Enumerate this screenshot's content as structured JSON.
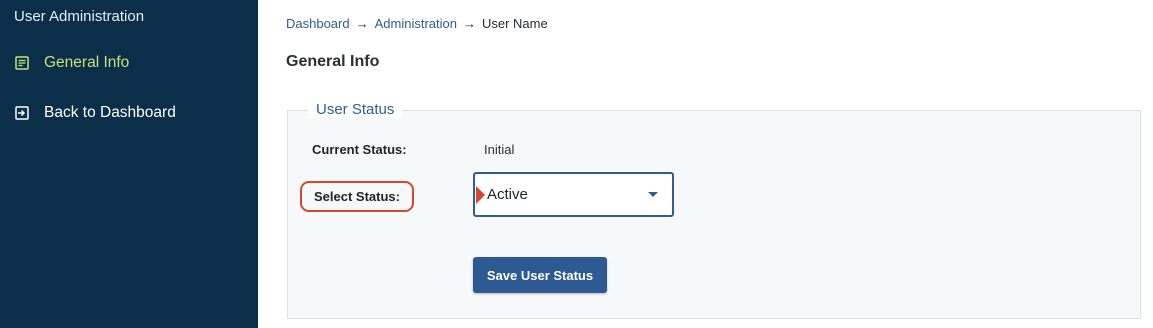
{
  "sidebar": {
    "title": "User Administration",
    "items": [
      {
        "label": "General Info",
        "icon": "list-icon",
        "active": true
      },
      {
        "label": "Back to Dashboard",
        "icon": "exit-icon",
        "active": false
      }
    ]
  },
  "breadcrumb": {
    "items": [
      "Dashboard",
      "Administration",
      "User Name"
    ],
    "separator": "→"
  },
  "page": {
    "title": "General Info"
  },
  "user_status": {
    "legend": "User Status",
    "current_status_label": "Current Status:",
    "current_status_value": "Initial",
    "select_status_label": "Select Status:",
    "select_status_value": "Active",
    "save_button_label": "Save User Status"
  },
  "colors": {
    "sidebar_bg": "#0b2f48",
    "active_item": "#c5e27a",
    "accent": "#2e5d8f",
    "highlight": "#d9472b",
    "button_bg": "#2e5a93"
  }
}
